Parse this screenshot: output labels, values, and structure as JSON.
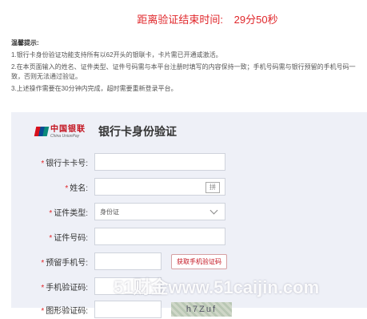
{
  "countdown": {
    "label": "距离验证结束时间:",
    "time": "29分50秒"
  },
  "tips": {
    "title": "温馨提示:",
    "items": [
      "1.银行卡身份验证功能支持所有以62开头的银联卡，卡片需已开通或激活。",
      "2.在本页面输入的姓名、证件类型、证件号码需与本平台注册时填写的内容保持一致；手机号码需与银行预留的手机号码一致，否则无法通过验证。",
      "3.上述操作需要在30分钟内完成，超时需要重新登录平台。"
    ]
  },
  "brand": {
    "cn": "中国银联",
    "en": "China UnionPay",
    "logo_text": "UnionPay 银联"
  },
  "panel_title": "银行卡身份验证",
  "form": {
    "card_no": {
      "label": "银行卡卡号:",
      "value": ""
    },
    "name": {
      "label": "姓名:",
      "value": "",
      "icon": "keyboard-icon",
      "icon_text": "拼"
    },
    "id_type": {
      "label": "证件类型:",
      "value": "身份证"
    },
    "id_no": {
      "label": "证件号码:",
      "value": ""
    },
    "phone": {
      "label": "预留手机号:",
      "value": "",
      "button": "获取手机验证码"
    },
    "sms_code": {
      "label": "手机验证码:",
      "value": ""
    },
    "captcha": {
      "label": "图形验证码:",
      "image_text": "h7Zuf"
    }
  },
  "watermark": "51财金www.51caijin.com"
}
